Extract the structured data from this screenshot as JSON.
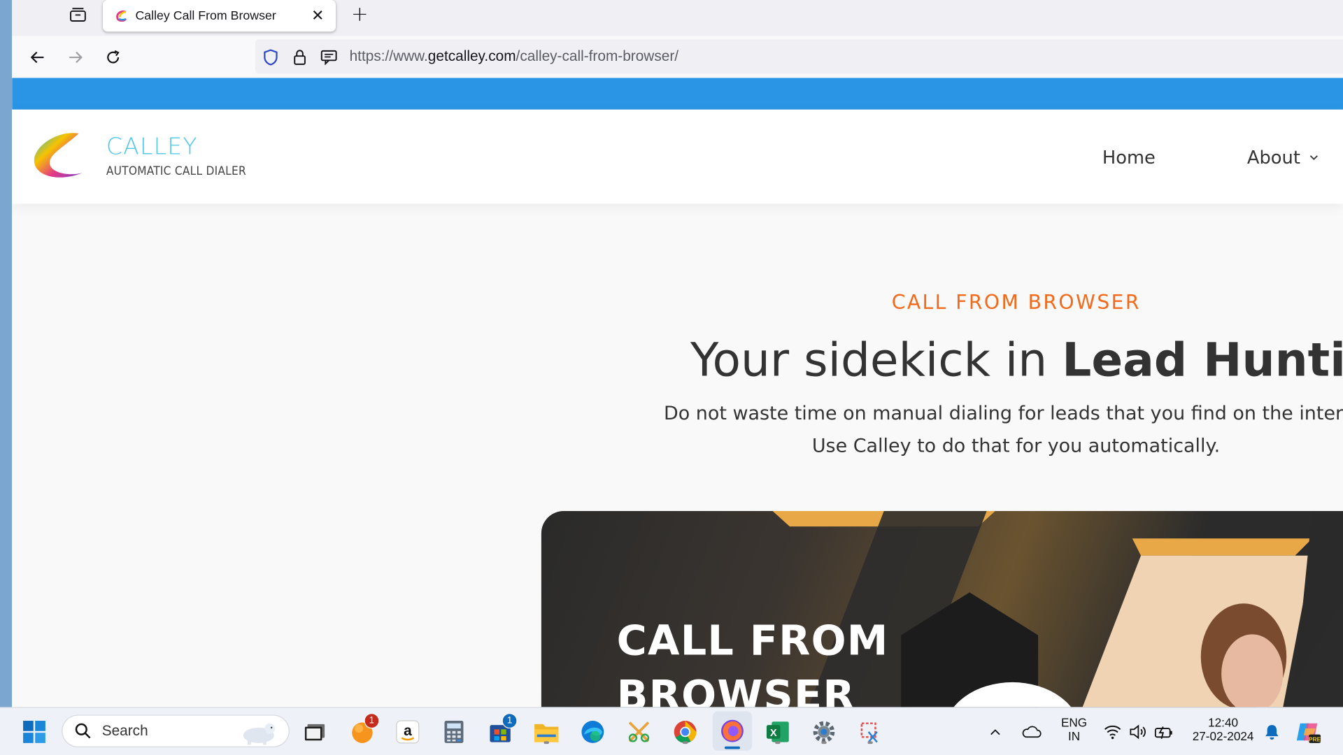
{
  "browser": {
    "tab_title": "Calley Call From Browser",
    "close_glyph": "✕",
    "new_tab_glyph": "+",
    "url_prefix": "https://www.",
    "url_host": "getcalley.com",
    "url_path": "/calley-call-from-browser/"
  },
  "site": {
    "logo_name": "CALLEY",
    "logo_tagline": "AUTOMATIC CALL DIALER",
    "nav": {
      "home": "Home",
      "about": "About"
    },
    "eyebrow": "CALL FROM BROWSER",
    "hero_title_plain": "Your sidekick in ",
    "hero_title_bold": "Lead Hunting",
    "hero_sub_line1": "Do not waste time on manual dialing for leads that you find on the interne",
    "hero_sub_line2": "Use Calley to do that for you automatically.",
    "banner_line1": "CALL FROM",
    "banner_line2": "BROWSER",
    "topstrip_color": "#2a95e5",
    "eyebrow_color": "#f26a1b"
  },
  "taskbar": {
    "search_label": "Search",
    "badge_orange_app": "1",
    "badge_store": "1",
    "lang_line1": "ENG",
    "lang_line2": "IN",
    "time": "12:40",
    "date": "27-02-2024",
    "apps": [
      "windows-start-icon",
      "search-icon",
      "task-view-icon",
      "orange-app-icon",
      "amazon-icon",
      "calculator-icon",
      "microsoft-store-icon",
      "file-explorer-icon",
      "edge-icon",
      "snipping-tool-icon",
      "chrome-icon",
      "firefox-icon",
      "excel-icon",
      "settings-icon",
      "snip-sketch-icon"
    ]
  }
}
